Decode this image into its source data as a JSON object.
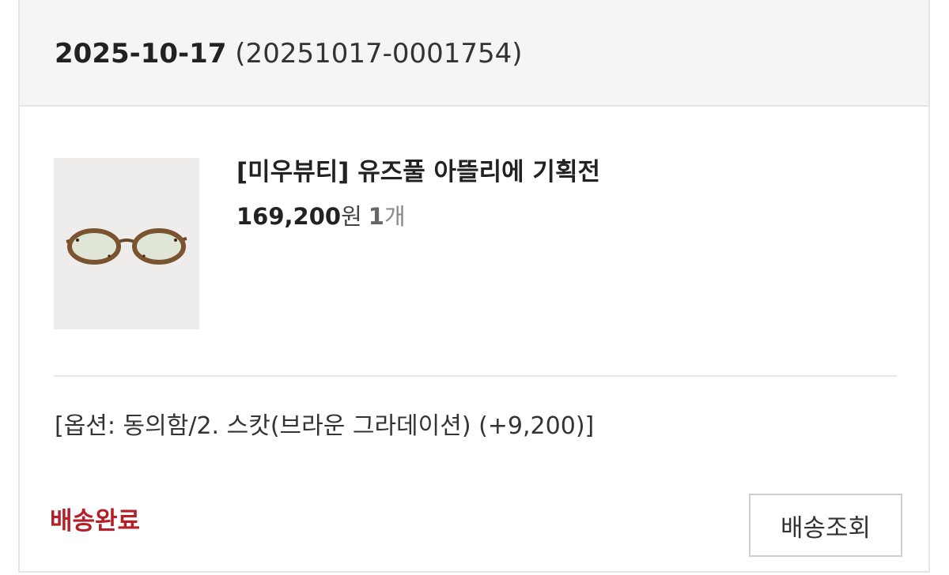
{
  "order": {
    "date": "2025-10-17",
    "number": "(20251017-0001754)"
  },
  "product": {
    "name": "[미우뷰티] 유즈풀 아뜰리에 기획전",
    "price": "169,200",
    "price_unit": "원",
    "quantity": "1",
    "quantity_unit": "개",
    "image_icon": "eyeglasses-icon"
  },
  "option": {
    "text": "[옵션: 동의함/2. 스캇(브라운 그라데이션) (+9,200)]"
  },
  "delivery": {
    "status": "배송완료",
    "track_label": "배송조회"
  },
  "colors": {
    "status_red": "#b3202a",
    "header_bg": "#f5f5f5"
  }
}
